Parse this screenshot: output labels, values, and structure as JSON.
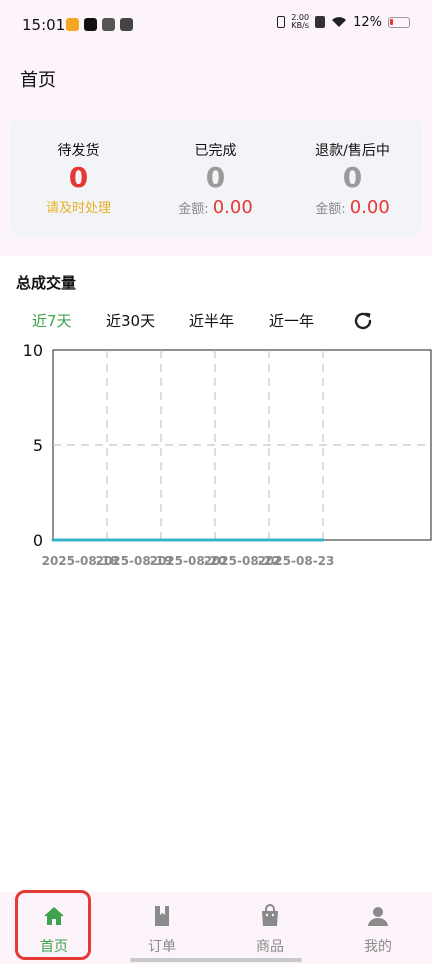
{
  "status_bar": {
    "time": "15:01",
    "net_speed_value": "2.00",
    "net_speed_unit": "KB/s",
    "battery_text": "12%"
  },
  "app_bar": {
    "title": "首页"
  },
  "summary": {
    "to_ship": {
      "title": "待发货",
      "value": "0",
      "note": "请及时处理"
    },
    "completed": {
      "title": "已完成",
      "value": "0",
      "amount_label": "金额:",
      "amount": "0.00"
    },
    "refund": {
      "title": "退款/售后中",
      "value": "0",
      "amount_label": "金额:",
      "amount": "0.00"
    }
  },
  "volume": {
    "title": "总成交量",
    "ranges": [
      "近7天",
      "近30天",
      "近半年",
      "近一年"
    ],
    "active_range": "近7天"
  },
  "chart_data": {
    "type": "line",
    "x": [
      "2025-08-18",
      "2025-08-19",
      "2025-08-20",
      "2025-08-22",
      "2025-08-23"
    ],
    "series": [
      {
        "values": [
          0,
          0,
          0,
          0,
          0
        ]
      }
    ],
    "y_ticks": [
      "0",
      "5",
      "10"
    ],
    "ylim": [
      0,
      10
    ],
    "grid": true,
    "line_color": "#35b3c9"
  },
  "bottom_nav": {
    "items": [
      {
        "label": "首页",
        "icon": "home-icon",
        "active": true
      },
      {
        "label": "订单",
        "icon": "book-icon",
        "active": false
      },
      {
        "label": "商品",
        "icon": "bag-icon",
        "active": false
      },
      {
        "label": "我的",
        "icon": "person-icon",
        "active": false
      }
    ]
  },
  "colors": {
    "accent_green": "#3fa34d",
    "red": "#e53935",
    "warning_yellow": "#e8b024"
  }
}
